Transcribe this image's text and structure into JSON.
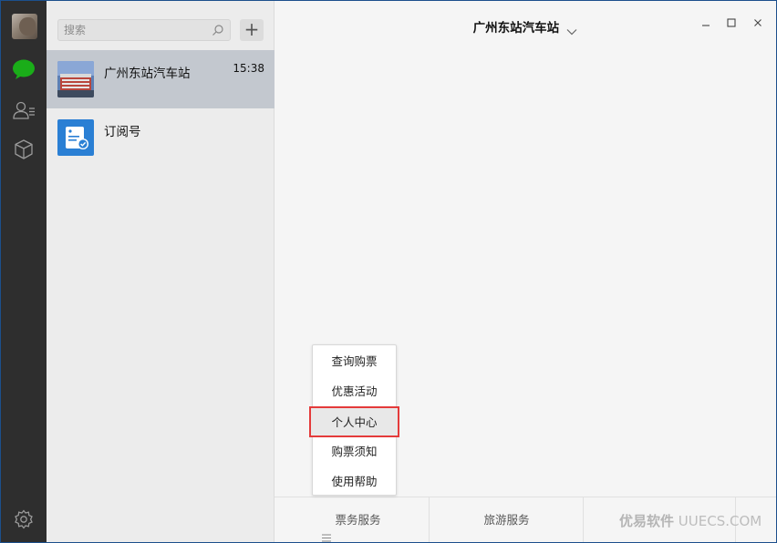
{
  "sidebar": {
    "icons": [
      "avatar",
      "chat-icon",
      "contacts-icon",
      "box-icon",
      "settings-icon"
    ],
    "active_color": "#1aad19"
  },
  "list": {
    "search": {
      "placeholder": "搜索",
      "value": ""
    },
    "add_label": "+",
    "items": [
      {
        "name": "广州东站汽车站",
        "time": "15:38",
        "active": true
      },
      {
        "name": "订阅号",
        "time": "",
        "active": false
      }
    ]
  },
  "main": {
    "title": "广州东站汽车站",
    "menu": [
      {
        "label": "票务服务"
      },
      {
        "label": "旅游服务"
      }
    ],
    "popup": {
      "items": [
        "查询购票",
        "优惠活动",
        "个人中心",
        "购票须知",
        "使用帮助"
      ],
      "highlighted": "个人中心"
    }
  },
  "watermark": {
    "brand": "优易软件",
    "domain": "UUECS.COM"
  },
  "colors": {
    "rail": "#2e2e2e",
    "highlight_border": "#e43a3a",
    "subscription_blue": "#2a7fd4"
  }
}
